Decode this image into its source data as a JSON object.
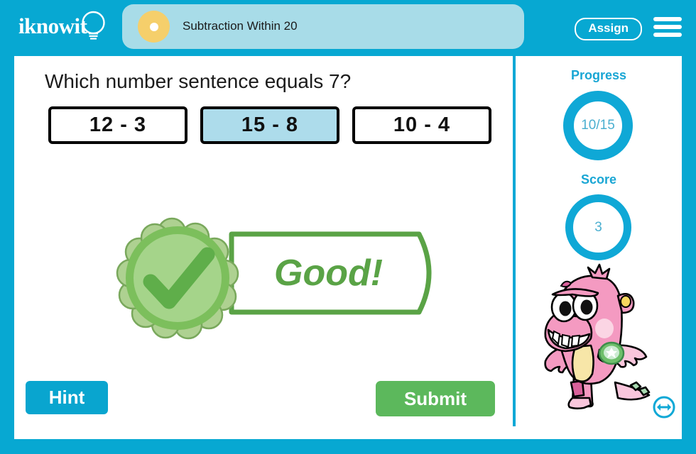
{
  "header": {
    "logo_text": "iknowit",
    "logo_icon": "lightbulb-icon",
    "lesson_title": "Subtraction Within 20",
    "assign_label": "Assign",
    "menu_icon": "hamburger-menu-icon"
  },
  "question": {
    "prompt": "Which number sentence equals 7?",
    "choices": [
      {
        "label": "12 - 3",
        "selected": false
      },
      {
        "label": "15 - 8",
        "selected": true
      },
      {
        "label": "10 - 4",
        "selected": false
      }
    ]
  },
  "feedback": {
    "text": "Good!",
    "icon": "check-medal-icon",
    "state": "correct"
  },
  "panel": {
    "progress_label": "Progress",
    "progress_value": "10/15",
    "score_label": "Score",
    "score_value": "3",
    "mascot_icon": "pink-monster-mascot",
    "resize_icon": "resize-horizontal-icon"
  },
  "actions": {
    "hint_label": "Hint",
    "submit_label": "Submit"
  },
  "colors": {
    "brand_teal": "#07A8D2",
    "title_pill": "#A8DCE8",
    "accent_yellow": "#F5CF6B",
    "selected_choice": "#ADDCEB",
    "correct_green": "#5AA346",
    "submit_green": "#5CB85C",
    "hint_blue": "#09A5CF",
    "ring_blue": "#0FA8D6",
    "mascot_pink": "#F49AC1"
  }
}
